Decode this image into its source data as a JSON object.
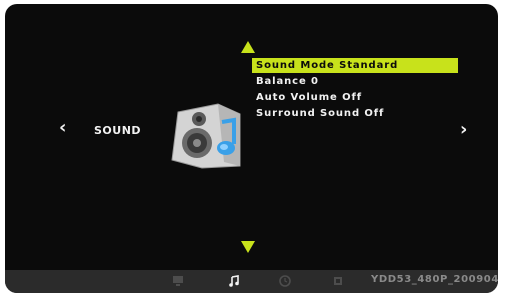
{
  "category": {
    "title": "SOUND",
    "left_arrow": "‹",
    "right_arrow": "›",
    "icon": "speaker-icon"
  },
  "menu": {
    "items": [
      {
        "label": "Sound Mode Standard",
        "selected": true
      },
      {
        "label": "Balance 0",
        "selected": false
      },
      {
        "label": "Auto Volume Off",
        "selected": false
      },
      {
        "label": "Surround Sound Off",
        "selected": false
      }
    ]
  },
  "bottom_bar": {
    "tabs": [
      {
        "icon": "picture-icon",
        "active": false
      },
      {
        "icon": "sound-note-icon",
        "active": true
      },
      {
        "icon": "clock-icon",
        "active": false
      },
      {
        "icon": "settings-icon",
        "active": false
      }
    ],
    "model_text": "YDD53_480P_200904"
  },
  "colors": {
    "accent": "#c8e21b",
    "background": "#0b0b0b",
    "text": "#f2f2f2",
    "bottom_bar": "#2b2b2b"
  }
}
